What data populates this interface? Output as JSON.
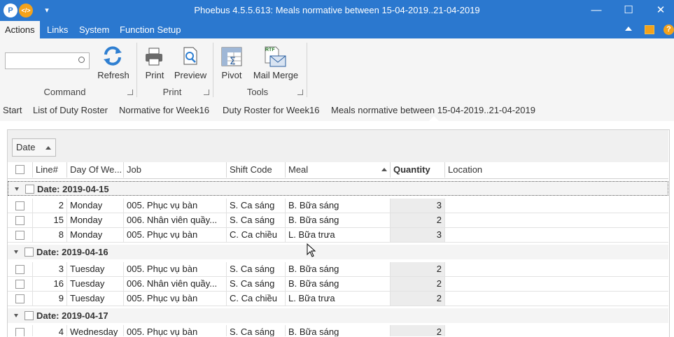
{
  "titlebar": {
    "title": "Phoebus 4.5.5.613: Meals normative between 15-04-2019..21-04-2019",
    "app_badge": "P",
    "code_badge": "</>",
    "dropdown_glyph": "▾",
    "minimize": "—",
    "maximize": "☐",
    "close": "✕"
  },
  "menubar": {
    "items": [
      "Actions",
      "Links",
      "System",
      "Function Setup"
    ],
    "right_icons": [
      "chevron-up-icon",
      "layout-icon",
      "help-icon"
    ],
    "help_glyph": "?"
  },
  "ribbon": {
    "search_value": "",
    "refresh_label": "Refresh",
    "command_group": "Command",
    "print_label": "Print",
    "preview_label": "Preview",
    "print_group": "Print",
    "pivot_label": "Pivot",
    "mailmerge_label": "Mail Merge",
    "tools_group": "Tools",
    "rtf_badge": "RTF"
  },
  "breadcrumbs": [
    "Start",
    "List of Duty Roster",
    "Normative for Week16",
    "Duty Roster for Week16",
    "Meals normative between 15-04-2019..21-04-2019"
  ],
  "grid": {
    "group_chip": "Date",
    "columns": {
      "line": "Line#",
      "day": "Day Of We...",
      "job": "Job",
      "shift": "Shift Code",
      "meal": "Meal",
      "qty": "Quantity",
      "location": "Location"
    },
    "groups": [
      {
        "title": "Date: 2019-04-15",
        "rows": [
          {
            "line": "2",
            "day": "Monday",
            "job": "005. Phục vụ bàn",
            "shift": "S. Ca sáng",
            "meal": "B. Bữa sáng",
            "qty": "3",
            "location": ""
          },
          {
            "line": "15",
            "day": "Monday",
            "job": "006. Nhân viên quầy...",
            "shift": "S. Ca sáng",
            "meal": "B. Bữa sáng",
            "qty": "2",
            "location": ""
          },
          {
            "line": "8",
            "day": "Monday",
            "job": "005. Phục vụ bàn",
            "shift": "C. Ca chiều",
            "meal": "L. Bữa trưa",
            "qty": "3",
            "location": ""
          }
        ]
      },
      {
        "title": "Date: 2019-04-16",
        "rows": [
          {
            "line": "3",
            "day": "Tuesday",
            "job": "005. Phục vụ bàn",
            "shift": "S. Ca sáng",
            "meal": "B. Bữa sáng",
            "qty": "2",
            "location": ""
          },
          {
            "line": "16",
            "day": "Tuesday",
            "job": "006. Nhân viên quầy...",
            "shift": "S. Ca sáng",
            "meal": "B. Bữa sáng",
            "qty": "2",
            "location": ""
          },
          {
            "line": "9",
            "day": "Tuesday",
            "job": "005. Phục vụ bàn",
            "shift": "C. Ca chiều",
            "meal": "L. Bữa trưa",
            "qty": "2",
            "location": ""
          }
        ]
      },
      {
        "title": "Date: 2019-04-17",
        "rows": [
          {
            "line": "4",
            "day": "Wednesday",
            "job": "005. Phục vụ bàn",
            "shift": "S. Ca sáng",
            "meal": "B. Bữa sáng",
            "qty": "2",
            "location": ""
          }
        ]
      }
    ]
  },
  "colors": {
    "titlebar": "#2b78cf",
    "ribbon": "#f5f5f5",
    "group_row": "#f4f4f4",
    "quantity_col": "#ececec",
    "refresh_icon": "#2f7fd1"
  }
}
